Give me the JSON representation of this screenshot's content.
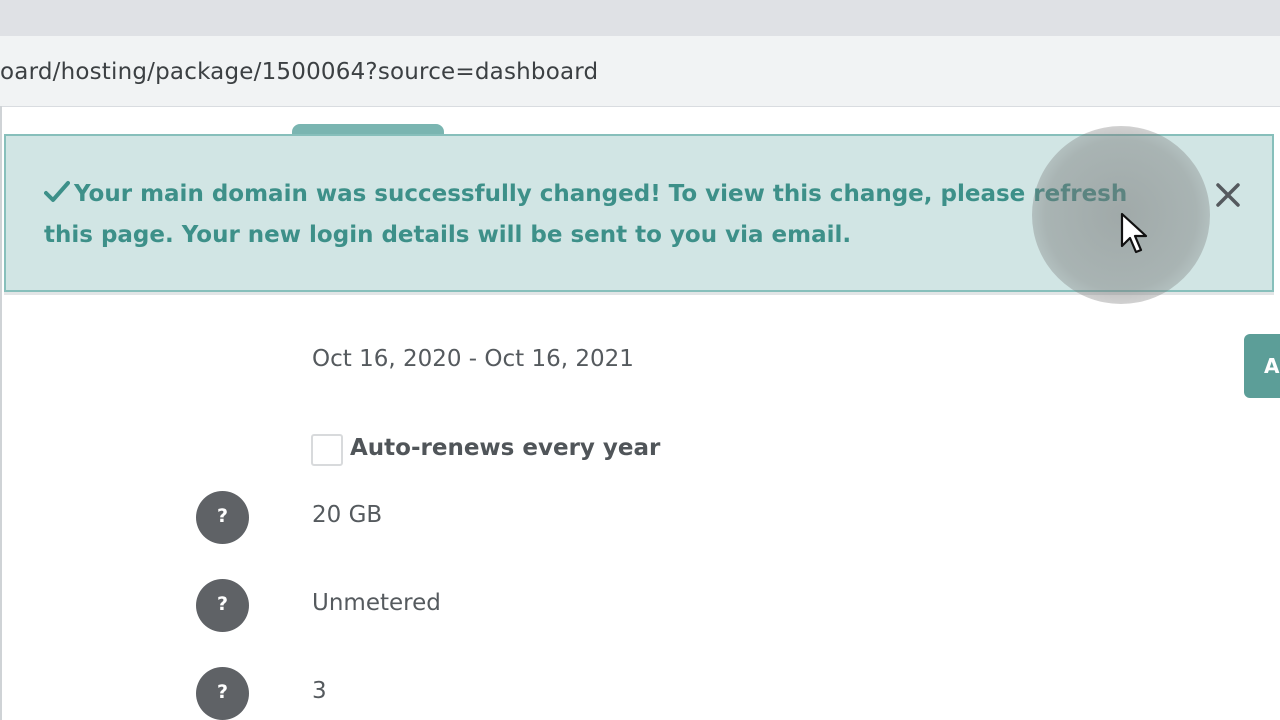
{
  "browser": {
    "url": "oard/hosting/package/1500064?source=dashboard"
  },
  "alert": {
    "message": "Your main domain was successfully changed! To view this change, please refresh this page. Your new login details will be sent to you via email.",
    "icon": "check-icon",
    "close_icon": "close-icon",
    "color": "#3d9089",
    "background": "#d1e5e4"
  },
  "package": {
    "date_range": "Oct 16, 2020 - Oct 16, 2021",
    "edge_button_label": "A",
    "auto_renew": {
      "label": "Auto-renews every year",
      "checked": false
    },
    "details": [
      {
        "help_label": "?",
        "value": "20 GB"
      },
      {
        "help_label": "?",
        "value": "Unmetered"
      },
      {
        "help_label": "?",
        "value": "3"
      }
    ]
  },
  "colors": {
    "accent": "#5c9e98",
    "help_icon": "#5f6266"
  }
}
